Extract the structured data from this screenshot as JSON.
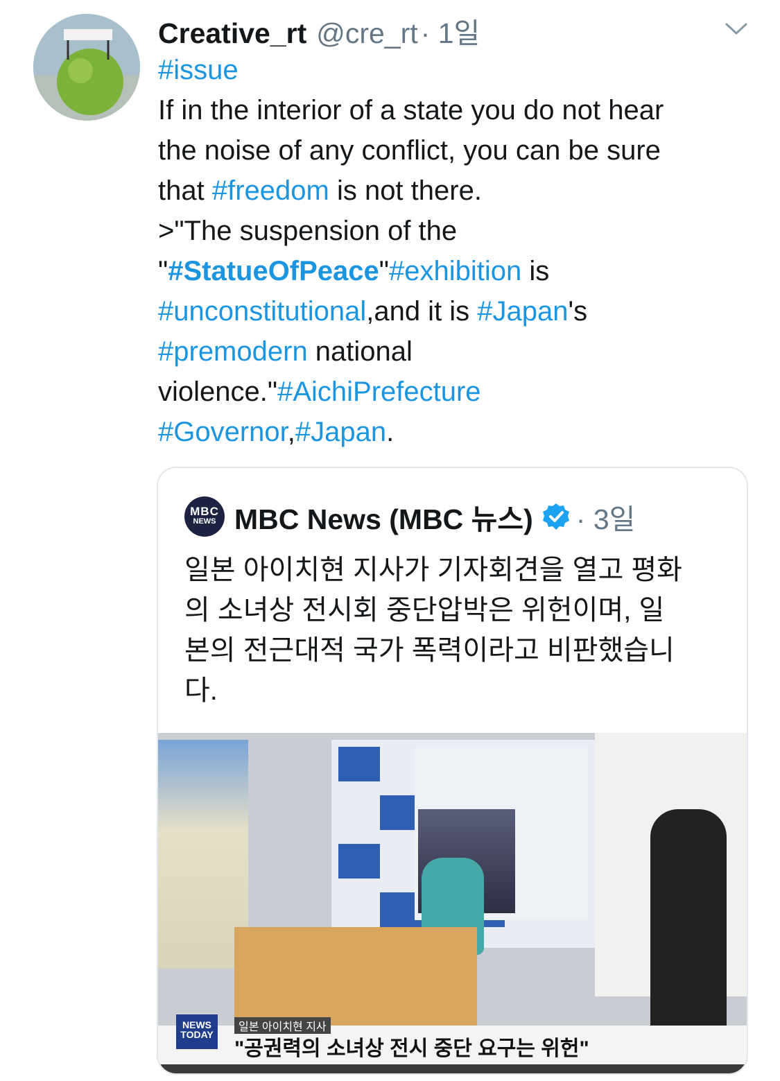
{
  "tweet": {
    "author_name": "Creative_rt",
    "author_handle": "@cre_rt",
    "time": "· 1일",
    "lines": [
      [
        {
          "t": "#issue",
          "tag": true
        }
      ],
      [
        {
          "t": "If in the interior of a state you do not hear"
        }
      ],
      [
        {
          "t": "the noise of any conflict, you can be sure"
        }
      ],
      [
        {
          "t": "that "
        },
        {
          "t": "#freedom",
          "tag": true
        },
        {
          "t": " is not there."
        }
      ],
      [
        {
          "t": ">\"The suspension of the"
        }
      ],
      [
        {
          "t": "\""
        },
        {
          "t": "#StatueOfPeace",
          "tag": true,
          "bold": true
        },
        {
          "t": "\""
        },
        {
          "t": "#exhibition",
          "tag": true
        },
        {
          "t": " is"
        }
      ],
      [
        {
          "t": "#unconstitutional",
          "tag": true
        },
        {
          "t": ",and it is "
        },
        {
          "t": "#Japan",
          "tag": true
        },
        {
          "t": "'s"
        }
      ],
      [
        {
          "t": "#premodern",
          "tag": true
        },
        {
          "t": " national"
        }
      ],
      [
        {
          "t": "violence.\""
        },
        {
          "t": "#AichiPrefecture",
          "tag": true
        }
      ],
      [
        {
          "t": "#Governor",
          "tag": true
        },
        {
          "t": ","
        },
        {
          "t": "#Japan",
          "tag": true
        },
        {
          "t": "."
        }
      ]
    ]
  },
  "quoted": {
    "logo_line1": "MBC",
    "logo_line2": "NEWS",
    "author_name": "MBC News (MBC 뉴스)",
    "time": "· 3일",
    "lines": [
      "일본 아이치현 지사가 기자회견을 열고 평화",
      "의 소녀상 전시회 중단압박은 위헌이며, 일",
      "본의 전근대적 국가 폭력이라고 비판했습니",
      "다."
    ],
    "media": {
      "news_badge": "NEWS TODAY",
      "caption_small": "일본 아이치현 지사",
      "caption": "\"공권력의 소녀상 전시 중단 요구는 위헌\""
    }
  },
  "colors": {
    "hashtag": "#1b95e0",
    "text": "#14171a",
    "muted": "#657786",
    "border": "#e1e8ed",
    "verified": "#1da1f2"
  }
}
